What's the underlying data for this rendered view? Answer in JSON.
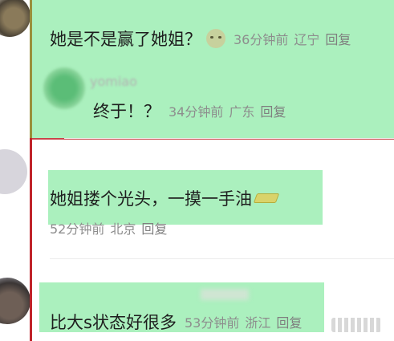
{
  "comments": [
    {
      "text": "她是不是赢了她姐？",
      "time": "36分钟前",
      "location": "辽宁",
      "reply_label": "回复",
      "emoji": "sweating-face-emoji"
    },
    {
      "user": "yomiao",
      "text": "终于！？",
      "time": "34分钟前",
      "location": "广东",
      "reply_label": "回复"
    },
    {
      "text": "她姐搂个光头，一摸一手油",
      "time": "52分钟前",
      "location": "北京",
      "reply_label": "回复",
      "emoji": "oil-bottle-emoji"
    },
    {
      "text": "比大s状态好很多",
      "time": "53分钟前",
      "location": "浙江",
      "reply_label": "回复"
    }
  ],
  "colors": {
    "highlight": "#78e696",
    "red_border": "#c0232a",
    "meta_text": "#8d8d8d"
  }
}
